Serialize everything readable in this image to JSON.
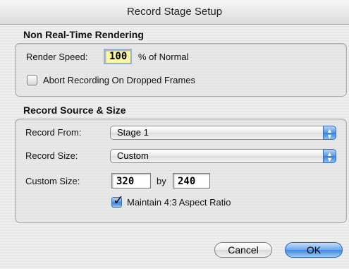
{
  "window": {
    "title": "Record Stage Setup"
  },
  "non_realtime": {
    "title": "Non Real-Time Rendering",
    "render_speed_label": "Render Speed:",
    "render_speed_value": "100",
    "render_speed_suffix": "% of Normal",
    "abort_label": "Abort Recording On Dropped Frames",
    "abort_checked": false
  },
  "record_source": {
    "title": "Record Source & Size",
    "record_from_label": "Record From:",
    "record_from_value": "Stage 1",
    "record_size_label": "Record Size:",
    "record_size_value": "Custom",
    "custom_size_label": "Custom Size:",
    "width_value": "320",
    "by_label": "by",
    "height_value": "240",
    "maintain_label": "Maintain 4:3 Aspect Ratio",
    "maintain_checked": true
  },
  "buttons": {
    "cancel_label": "Cancel",
    "ok_label": "OK"
  },
  "colors": {
    "accent": "#3f87dc",
    "focus_field": "#fff9a6"
  }
}
